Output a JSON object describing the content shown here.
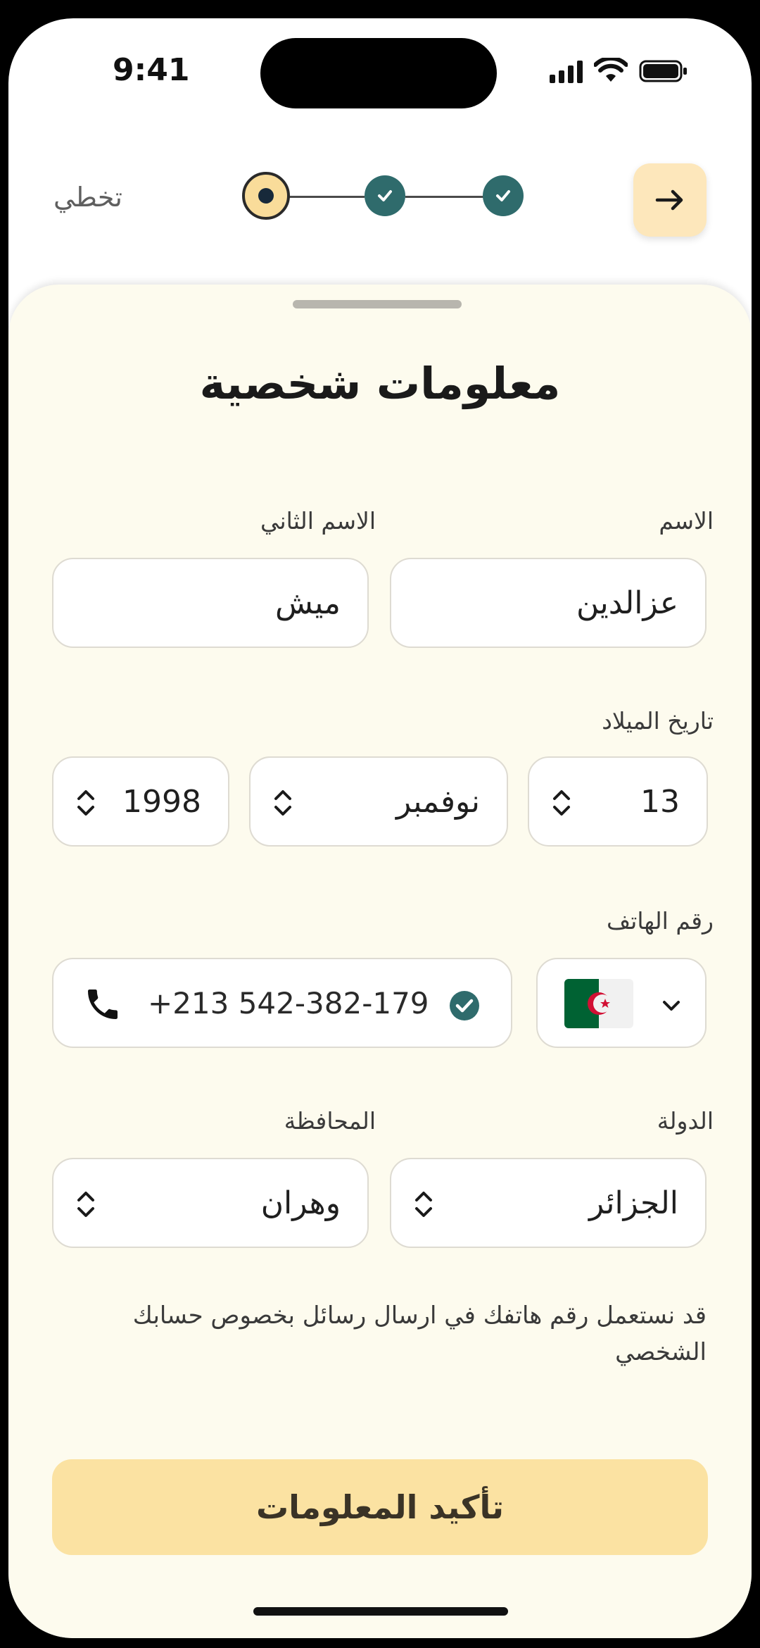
{
  "status_bar": {
    "time": "9:41"
  },
  "top_nav": {
    "skip_label": "تخطي"
  },
  "stepper": {
    "current_step": 1,
    "completed_steps": 2,
    "total_steps": 3
  },
  "form": {
    "title": "معلومات شخصية",
    "first_name": {
      "label": "الاسم",
      "value": "عزالدين"
    },
    "last_name": {
      "label": "الاسم الثاني",
      "value": "ميش"
    },
    "birth_date": {
      "label": "تاريخ الميلاد",
      "day": "13",
      "month": "نوفمبر",
      "year": "1998"
    },
    "phone": {
      "label": "رقم الهاتف",
      "value": "+213 542-382-179",
      "verified": true,
      "country_flag": "algeria-flag-icon"
    },
    "country": {
      "label": "الدولة",
      "value": "الجزائر"
    },
    "province": {
      "label": "المحافظة",
      "value": "وهران"
    },
    "note": "قد نستعمل رقم هاتفك في ارسال رسائل بخصوص حسابك الشخصي",
    "confirm_label": "تأكيد المعلومات"
  },
  "colors": {
    "sheet_background": "#fdfbee",
    "accent_teal": "#2f6b6c",
    "button_yellow": "#fbe2a2",
    "next_button": "#fde7bb",
    "algeria_green": "#006233",
    "algeria_red": "#d21034"
  }
}
